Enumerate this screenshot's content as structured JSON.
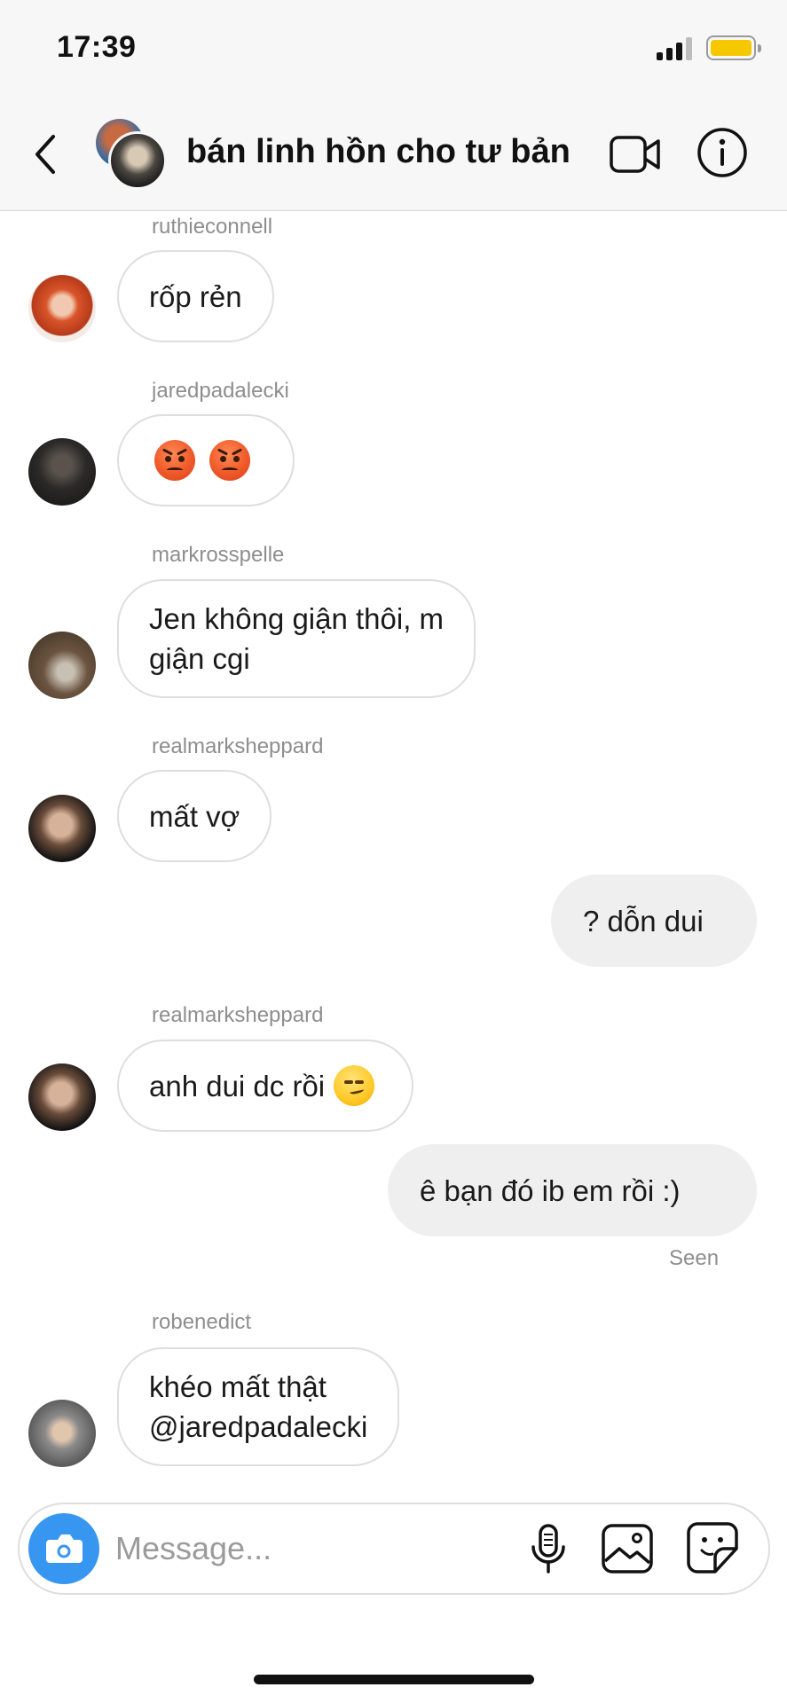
{
  "status_bar": {
    "time": "17:39",
    "battery_color": "#f5c800"
  },
  "header": {
    "title": "bán linh hồn cho tư bản",
    "back_icon": "chevron-left-icon",
    "video_icon": "video-call-icon",
    "info_icon": "info-icon"
  },
  "messages": [
    {
      "username": "ruthieconnell",
      "text": "rốp rẻn",
      "direction": "incoming"
    },
    {
      "username": "jaredpadalecki",
      "text": "",
      "emoji": [
        "angry-face",
        "angry-face"
      ],
      "direction": "incoming"
    },
    {
      "username": "markrosspelle",
      "lines": [
        "Jen không giận thôi, m",
        "giận cgi"
      ],
      "direction": "incoming"
    },
    {
      "username": "realmarksheppard",
      "text": "mất vợ",
      "direction": "incoming"
    },
    {
      "text": "? dỗn dui",
      "direction": "outgoing"
    },
    {
      "username": "realmarksheppard",
      "text": "anh dui dc rồi",
      "emoji": [
        "smirking-face"
      ],
      "direction": "incoming"
    },
    {
      "text": "ê bạn đó ib em rồi :)",
      "direction": "outgoing",
      "status": "Seen"
    },
    {
      "username": "robenedict",
      "lines": [
        "khéo mất thật",
        "@jaredpadalecki"
      ],
      "direction": "incoming"
    }
  ],
  "composer": {
    "placeholder": "Message...",
    "camera_color": "#3797f0",
    "icons": [
      "camera-icon",
      "microphone-icon",
      "gallery-icon",
      "sticker-icon"
    ]
  }
}
